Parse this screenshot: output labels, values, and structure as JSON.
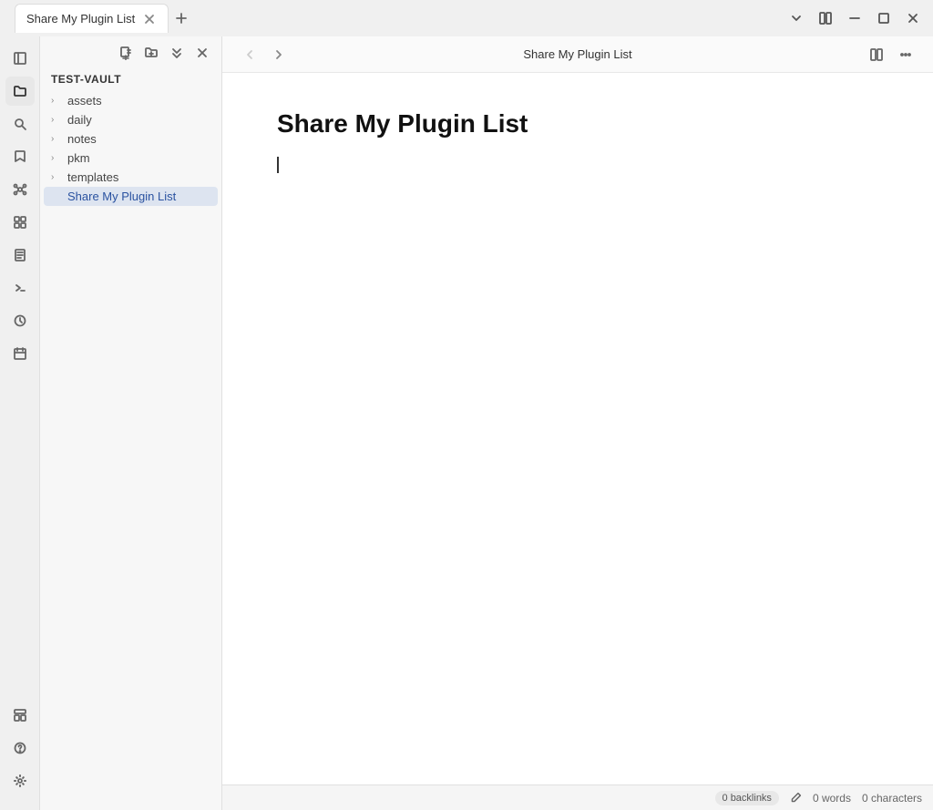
{
  "titleBar": {
    "tab": "Share My Plugin List",
    "dropdownIcon": "chevron-down",
    "splitIcon": "split",
    "minimizeIcon": "minimize",
    "maximizeIcon": "maximize",
    "closeIcon": "close"
  },
  "activityBar": {
    "icons": [
      {
        "name": "sidebar-toggle-icon",
        "symbol": "sidebar"
      },
      {
        "name": "file-explorer-icon",
        "symbol": "folder"
      },
      {
        "name": "search-icon",
        "symbol": "search"
      },
      {
        "name": "bookmark-icon",
        "symbol": "bookmark"
      },
      {
        "name": "graph-icon",
        "symbol": "graph"
      },
      {
        "name": "extensions-icon",
        "symbol": "extensions"
      },
      {
        "name": "pages-icon",
        "symbol": "pages"
      },
      {
        "name": "terminal-icon",
        "symbol": "terminal"
      },
      {
        "name": "clock-icon",
        "symbol": "clock"
      },
      {
        "name": "calendar-icon",
        "symbol": "calendar"
      }
    ],
    "bottomIcons": [
      {
        "name": "template-icon",
        "symbol": "template"
      },
      {
        "name": "help-icon",
        "symbol": "help"
      },
      {
        "name": "settings-icon",
        "symbol": "settings"
      }
    ]
  },
  "sidebar": {
    "tools": [
      {
        "name": "new-note-tool",
        "label": "New note"
      },
      {
        "name": "new-folder-tool",
        "label": "New folder"
      },
      {
        "name": "collapse-all-tool",
        "label": "Collapse all"
      },
      {
        "name": "close-tool",
        "label": "Close"
      }
    ],
    "vaultName": "TEST-VAULT",
    "items": [
      {
        "id": "assets",
        "label": "assets",
        "expanded": false
      },
      {
        "id": "daily",
        "label": "daily",
        "expanded": false
      },
      {
        "id": "notes",
        "label": "notes",
        "expanded": false
      },
      {
        "id": "pkm",
        "label": "pkm",
        "expanded": false
      },
      {
        "id": "templates",
        "label": "templates",
        "expanded": false
      },
      {
        "id": "share-my-plugin-list",
        "label": "Share My Plugin List",
        "expanded": false,
        "selected": true
      }
    ]
  },
  "contentArea": {
    "backButtonDisabled": true,
    "forwardButtonDisabled": false,
    "title": "Share My Plugin List",
    "documentTitle": "Share My Plugin List"
  },
  "statusBar": {
    "backlinksLabel": "0 backlinks",
    "editIcon": "edit",
    "wordsLabel": "0 words",
    "charsLabel": "0 characters"
  }
}
